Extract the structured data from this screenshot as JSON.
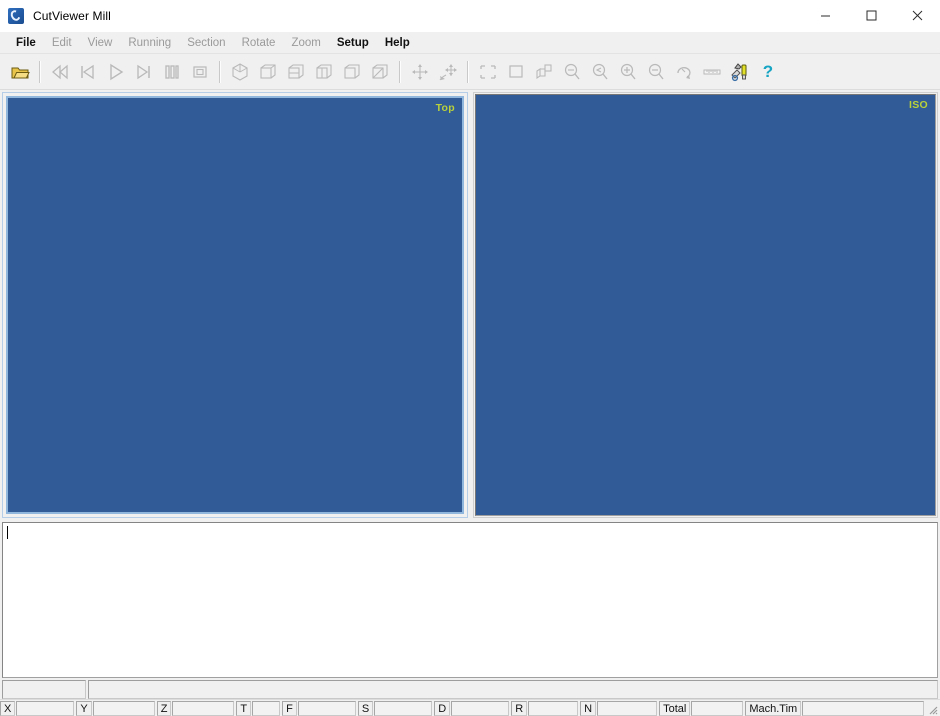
{
  "window": {
    "title": "CutViewer Mill",
    "icon": "app-logo-icon",
    "minimize_label": "Minimize",
    "maximize_label": "Maximize",
    "close_label": "Close"
  },
  "menu": {
    "items": [
      {
        "label": "File",
        "enabled": true
      },
      {
        "label": "Edit",
        "enabled": false
      },
      {
        "label": "View",
        "enabled": false
      },
      {
        "label": "Running",
        "enabled": false
      },
      {
        "label": "Section",
        "enabled": false
      },
      {
        "label": "Rotate",
        "enabled": false
      },
      {
        "label": "Zoom",
        "enabled": false
      },
      {
        "label": "Setup",
        "enabled": true
      },
      {
        "label": "Help",
        "enabled": true
      }
    ]
  },
  "toolbar": {
    "buttons": [
      {
        "name": "open-file-icon",
        "tooltip": "Open",
        "enabled": true
      },
      {
        "name": "rewind-icon",
        "tooltip": "Rewind",
        "enabled": false
      },
      {
        "name": "step-to-start-icon",
        "tooltip": "Go To Start",
        "enabled": false
      },
      {
        "name": "play-icon",
        "tooltip": "Run",
        "enabled": false
      },
      {
        "name": "step-to-end-icon",
        "tooltip": "Go To End",
        "enabled": false
      },
      {
        "name": "pause-icon",
        "tooltip": "Pause",
        "enabled": false
      },
      {
        "name": "stop-icon",
        "tooltip": "Stop",
        "enabled": false
      },
      {
        "name": "view-isometric-icon",
        "tooltip": "Isometric View",
        "enabled": false
      },
      {
        "name": "view-cube-1-icon",
        "tooltip": "View 1",
        "enabled": false
      },
      {
        "name": "view-cube-2-icon",
        "tooltip": "View 2",
        "enabled": false
      },
      {
        "name": "view-cube-3-icon",
        "tooltip": "View 3",
        "enabled": false
      },
      {
        "name": "view-cube-4-icon",
        "tooltip": "View 4",
        "enabled": false
      },
      {
        "name": "view-cube-5-icon",
        "tooltip": "View 5",
        "enabled": false
      },
      {
        "name": "pan-icon",
        "tooltip": "Pan",
        "enabled": false
      },
      {
        "name": "rotate-dynamic-icon",
        "tooltip": "Dynamic Rotate",
        "enabled": false
      },
      {
        "name": "zoom-window-icon",
        "tooltip": "Zoom Window",
        "enabled": false
      },
      {
        "name": "zoom-fit-icon",
        "tooltip": "Zoom Fit",
        "enabled": false
      },
      {
        "name": "zoom-part-icon",
        "tooltip": "Zoom Part",
        "enabled": false
      },
      {
        "name": "zoom-dynamic-icon",
        "tooltip": "Dynamic Zoom",
        "enabled": false
      },
      {
        "name": "zoom-previous-icon",
        "tooltip": "Zoom Previous",
        "enabled": false
      },
      {
        "name": "zoom-in-icon",
        "tooltip": "Zoom In",
        "enabled": false
      },
      {
        "name": "zoom-out-icon",
        "tooltip": "Zoom Out",
        "enabled": false
      },
      {
        "name": "rotate-view-icon",
        "tooltip": "Rotate View",
        "enabled": false
      },
      {
        "name": "measure-ruler-icon",
        "tooltip": "Measure",
        "enabled": false
      },
      {
        "name": "tool-setup-icon",
        "tooltip": "Tool Setup",
        "enabled": true
      },
      {
        "name": "help-icon",
        "tooltip": "Help",
        "enabled": true
      }
    ],
    "help_glyph": "?"
  },
  "viewports": [
    {
      "name": "viewport-top",
      "label": "Top",
      "active": true,
      "background": "#315b96",
      "label_color": "#b9d13a"
    },
    {
      "name": "viewport-iso",
      "label": "ISO",
      "active": false,
      "background": "#315b96",
      "label_color": "#b9d13a"
    }
  ],
  "editor": {
    "content": "",
    "placeholder": ""
  },
  "lower_panel": {
    "left_cell": "",
    "right_cell": ""
  },
  "statusbar": {
    "fields": [
      {
        "label": "X",
        "value": "",
        "value_width": 58
      },
      {
        "label": "Y",
        "value": "",
        "value_width": 62
      },
      {
        "label": "Z",
        "value": "",
        "value_width": 62
      },
      {
        "label": "T",
        "value": "",
        "value_width": 28
      },
      {
        "label": "F",
        "value": "",
        "value_width": 58
      },
      {
        "label": "S",
        "value": "",
        "value_width": 58
      },
      {
        "label": "D",
        "value": "",
        "value_width": 58
      },
      {
        "label": "R",
        "value": "",
        "value_width": 50
      },
      {
        "label": "N",
        "value": "",
        "value_width": 60
      },
      {
        "label": "Total",
        "value": "",
        "value_width": 52
      },
      {
        "label": "Mach.Tim",
        "value": "",
        "value_width": 160
      }
    ],
    "grip": "resize-grip"
  }
}
